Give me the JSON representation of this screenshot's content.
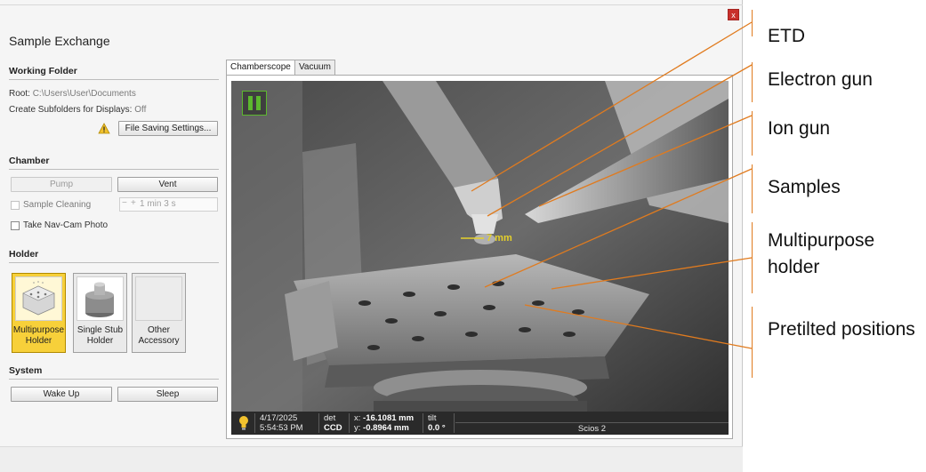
{
  "window": {
    "title": "Sample Exchange",
    "close_glyph": "x"
  },
  "working_folder": {
    "heading": "Working Folder",
    "root_label": "Root:",
    "root_value": "C:\\Users\\User\\Documents",
    "subfolders_label": "Create Subfolders for Displays:",
    "subfolders_value": "Off",
    "warning_icon": "warning-icon",
    "settings_button": "File Saving Settings..."
  },
  "chamber": {
    "heading": "Chamber",
    "pump_button": "Pump",
    "vent_button": "Vent",
    "cleaning_label": "Sample Cleaning",
    "cleaning_minus": "−",
    "cleaning_plus": "+",
    "cleaning_value": "1 min 3 s",
    "navcam_label": "Take Nav-Cam Photo"
  },
  "holder": {
    "heading": "Holder",
    "tiles": [
      {
        "label": "Multipurpose Holder",
        "selected": true
      },
      {
        "label": "Single Stub Holder",
        "selected": false
      },
      {
        "label": "Other Accessory",
        "selected": false
      }
    ]
  },
  "system": {
    "heading": "System",
    "wake_button": "Wake Up",
    "sleep_button": "Sleep"
  },
  "tabs": [
    {
      "label": "Chamberscope",
      "active": true
    },
    {
      "label": "Vacuum",
      "active": false
    }
  ],
  "camera": {
    "pause_icon": "pause-icon",
    "distance_label": "7 mm",
    "status": {
      "date": "4/17/2025",
      "time": "5:54:53 PM",
      "det_label": "det",
      "det_value": "CCD",
      "x_label": "x:",
      "x_value": "-16.1081 mm",
      "y_label": "y:",
      "y_value": "-0.8964 mm",
      "tilt_label": "tilt",
      "tilt_value": "0.0 °",
      "instrument": "Scios 2"
    }
  },
  "callouts": [
    "ETD",
    "Electron gun",
    "Ion gun",
    "Samples",
    "Multipurpose holder",
    "Pretilted positions"
  ],
  "colors": {
    "accent_orange": "#e07b1f",
    "selected_yellow": "#f7d03a",
    "pause_green": "#5cb82e"
  }
}
